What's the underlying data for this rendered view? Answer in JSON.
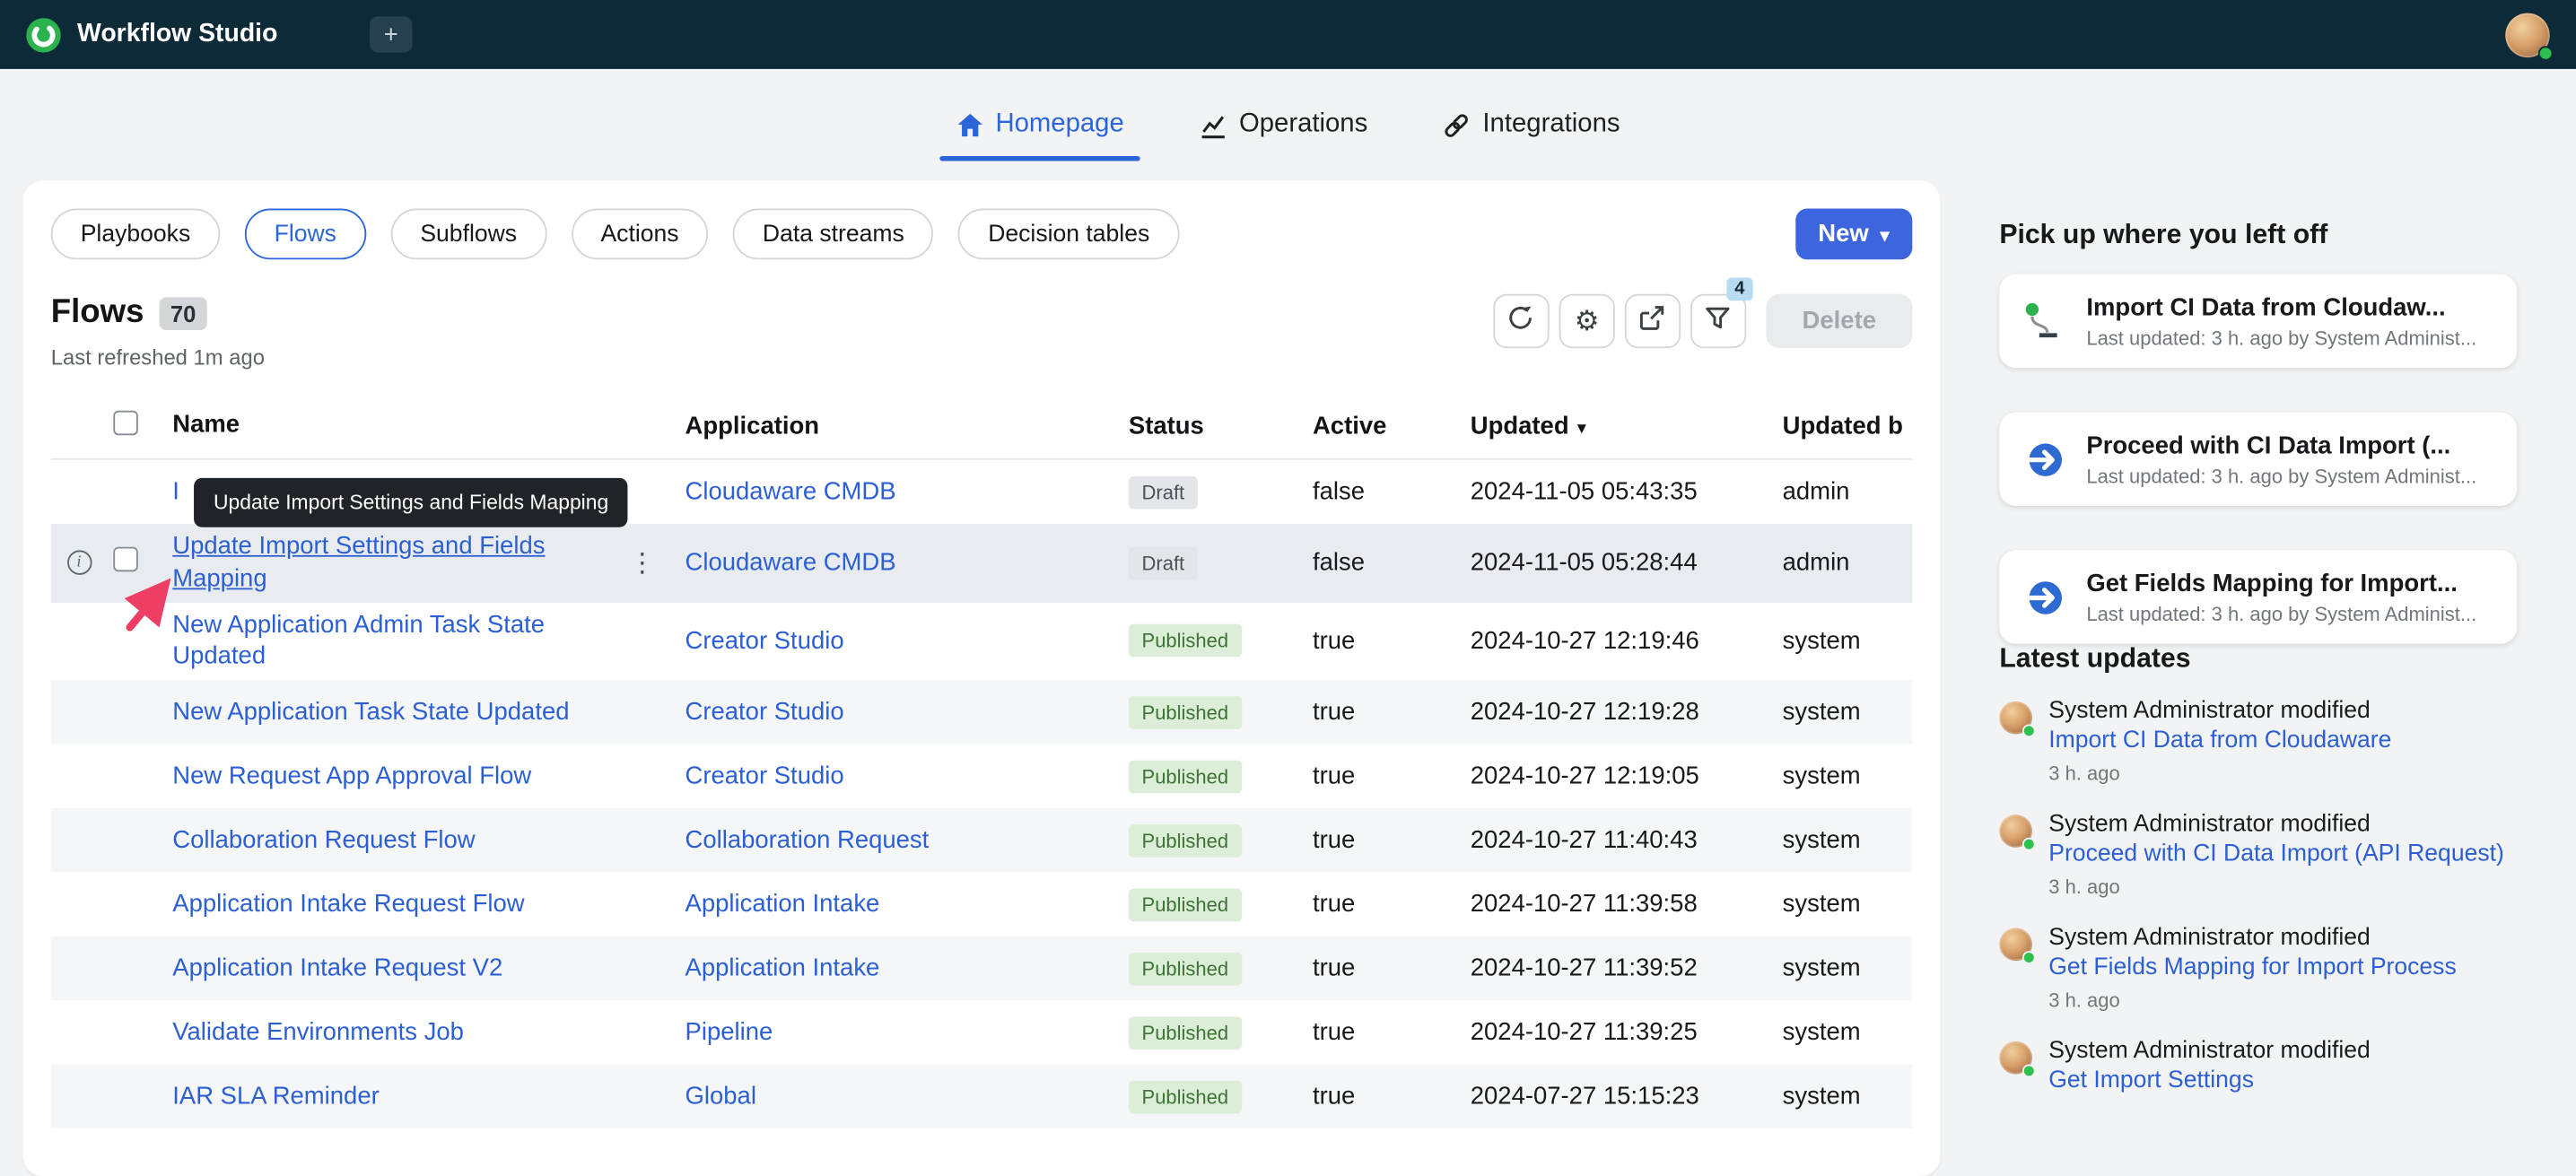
{
  "colors": {
    "topbar_bg": "#0d2a39",
    "accent_blue": "#2a65d9",
    "link_blue": "#2b5fd3",
    "primary_button_blue": "#3d66de",
    "logo_green": "#2bb24c",
    "published_badge_bg": "#dcedd8",
    "published_badge_text": "#3c7434",
    "draft_badge_bg": "#e3e5e8",
    "draft_badge_text": "#4c5156",
    "annotation_arrow": "#ee3e63"
  },
  "icons": {
    "kebab": "⋮",
    "sort_caret": "▾",
    "new_caret": "▾",
    "gear": "⚙",
    "plus": "+",
    "info": "i"
  },
  "topbar": {
    "app_title": "Workflow Studio"
  },
  "nav": {
    "tabs": [
      {
        "label": "Homepage",
        "icon": "home-icon",
        "active": true
      },
      {
        "label": "Operations",
        "icon": "chart-icon",
        "active": false
      },
      {
        "label": "Integrations",
        "icon": "link-icon",
        "active": false
      }
    ]
  },
  "toolbar": {
    "pills": [
      {
        "label": "Playbooks",
        "active": false
      },
      {
        "label": "Flows",
        "active": true
      },
      {
        "label": "Subflows",
        "active": false
      },
      {
        "label": "Actions",
        "active": false
      },
      {
        "label": "Data streams",
        "active": false
      },
      {
        "label": "Decision tables",
        "active": false
      }
    ],
    "new_button_label": "New",
    "delete_label": "Delete",
    "filter_count": "4"
  },
  "flows_header": {
    "title": "Flows",
    "count": "70",
    "refreshed": "Last refreshed 1m ago"
  },
  "tooltip": {
    "text": "Update Import Settings and Fields Mapping"
  },
  "table": {
    "columns": {
      "name": "Name",
      "application": "Application",
      "status": "Status",
      "active": "Active",
      "updated": "Updated",
      "updated_by": "Updated b"
    },
    "sort_column": "Updated",
    "rows": [
      {
        "name": "I",
        "application": "Cloudaware CMDB",
        "status": "Draft",
        "active": "false",
        "updated": "2024-11-05 05:43:35",
        "updated_by": "admin",
        "covered_by_tooltip": true
      },
      {
        "name": "Update Import Settings and Fields Mapping",
        "application": "Cloudaware CMDB",
        "status": "Draft",
        "active": "false",
        "updated": "2024-11-05 05:28:44",
        "updated_by": "admin",
        "hover": true
      },
      {
        "name": "New Application Admin Task State Updated",
        "application": "Creator Studio",
        "status": "Published",
        "active": "true",
        "updated": "2024-10-27 12:19:46",
        "updated_by": "system"
      },
      {
        "name": "New Application Task State Updated",
        "application": "Creator Studio",
        "status": "Published",
        "active": "true",
        "updated": "2024-10-27 12:19:28",
        "updated_by": "system"
      },
      {
        "name": "New Request App Approval Flow",
        "application": "Creator Studio",
        "status": "Published",
        "active": "true",
        "updated": "2024-10-27 12:19:05",
        "updated_by": "system"
      },
      {
        "name": "Collaboration Request Flow",
        "application": "Collaboration Request",
        "status": "Published",
        "active": "true",
        "updated": "2024-10-27 11:40:43",
        "updated_by": "system"
      },
      {
        "name": "Application Intake Request Flow",
        "application": "Application Intake",
        "status": "Published",
        "active": "true",
        "updated": "2024-10-27 11:39:58",
        "updated_by": "system"
      },
      {
        "name": "Application Intake Request V2",
        "application": "Application Intake",
        "status": "Published",
        "active": "true",
        "updated": "2024-10-27 11:39:52",
        "updated_by": "system"
      },
      {
        "name": "Validate Environments Job",
        "application": "Pipeline",
        "status": "Published",
        "active": "true",
        "updated": "2024-10-27 11:39:25",
        "updated_by": "system"
      },
      {
        "name": "IAR SLA Reminder",
        "application": "Global",
        "status": "Published",
        "active": "true",
        "updated": "2024-07-27 15:15:23",
        "updated_by": "system"
      }
    ]
  },
  "sidebar": {
    "pickup_title": "Pick up where you left off",
    "pickup_cards": [
      {
        "icon": "flow-start-icon",
        "title": "Import CI Data from Cloudaw...",
        "subtitle": "Last updated: 3 h. ago by System Administ..."
      },
      {
        "icon": "proceed-arrow-icon",
        "title": "Proceed with CI Data Import (...",
        "subtitle": "Last updated: 3 h. ago by System Administ..."
      },
      {
        "icon": "proceed-arrow-icon",
        "title": "Get Fields Mapping for Import...",
        "subtitle": "Last updated: 3 h. ago by System Administ..."
      }
    ],
    "updates_title": "Latest updates",
    "updates": [
      {
        "actor": "System Administrator modified",
        "target": "Import CI Data from Cloudaware",
        "time": "3 h. ago"
      },
      {
        "actor": "System Administrator modified",
        "target": "Proceed with CI Data Import (API Request)",
        "time": "3 h. ago"
      },
      {
        "actor": "System Administrator modified",
        "target": "Get Fields Mapping for Import Process",
        "time": "3 h. ago"
      },
      {
        "actor": "System Administrator modified",
        "target": "Get Import Settings",
        "time": ""
      }
    ]
  }
}
